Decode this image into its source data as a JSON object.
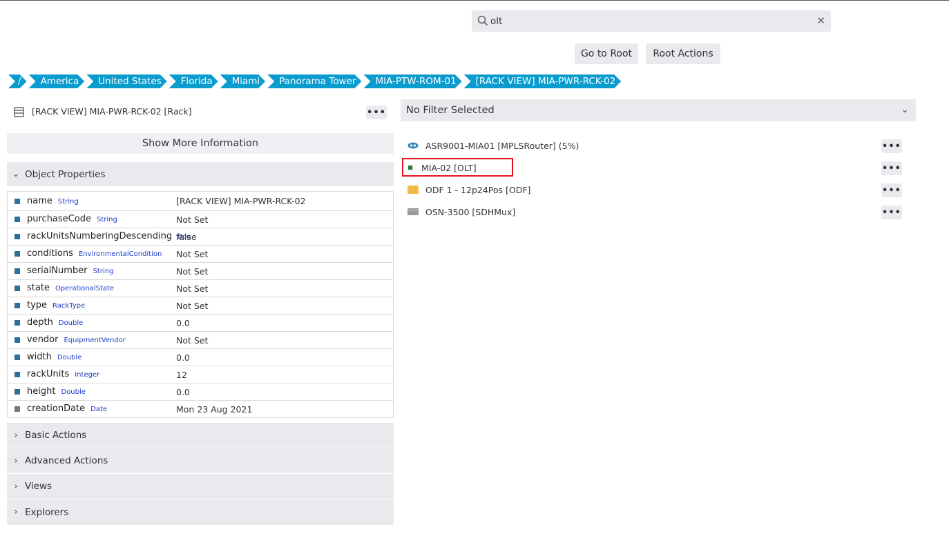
{
  "search": {
    "value": "olt"
  },
  "toolbar": {
    "go_root": "Go to Root",
    "root_actions": "Root Actions"
  },
  "breadcrumb": [
    "/",
    "America",
    "United States",
    "Florida",
    "Miami",
    "Panorama Tower",
    "MIA-PTW-ROM-01",
    "[RACK VIEW] MIA-PWR-RCK-02"
  ],
  "object": {
    "title": "[RACK VIEW] MIA-PWR-RCK-02 [Rack]",
    "more_info": "Show More Information",
    "properties_label": "Object Properties",
    "properties": [
      {
        "name": "name",
        "type": "String",
        "value": "[RACK VIEW] MIA-PWR-RCK-02"
      },
      {
        "name": "purchaseCode",
        "type": "String",
        "value": "Not Set"
      },
      {
        "name": "rackUnitsNumberingDescending",
        "type": "Boo",
        "value": "false"
      },
      {
        "name": "conditions",
        "type": "EnvironmentalCondition",
        "value": "Not Set"
      },
      {
        "name": "serialNumber",
        "type": "String",
        "value": "Not Set"
      },
      {
        "name": "state",
        "type": "OperationalState",
        "value": "Not Set"
      },
      {
        "name": "type",
        "type": "RackType",
        "value": "Not Set"
      },
      {
        "name": "depth",
        "type": "Double",
        "value": "0.0"
      },
      {
        "name": "vendor",
        "type": "EquipmentVendor",
        "value": "Not Set"
      },
      {
        "name": "width",
        "type": "Double",
        "value": "0.0"
      },
      {
        "name": "rackUnits",
        "type": "Integer",
        "value": "12"
      },
      {
        "name": "height",
        "type": "Double",
        "value": "0.0"
      },
      {
        "name": "creationDate",
        "type": "Date",
        "value": "Mon 23 Aug 2021"
      }
    ],
    "sections": [
      "Basic Actions",
      "Advanced Actions",
      "Views",
      "Explorers"
    ]
  },
  "filter": {
    "label": "No Filter Selected"
  },
  "children": [
    {
      "label": "ASR9001-MIA01 [MPLSRouter] (5%)",
      "icon": "router-icon"
    },
    {
      "label": "MIA-02 [OLT]",
      "icon": "olt-icon"
    },
    {
      "label": "ODF 1 - 12p24Pos [ODF]",
      "icon": "odf-icon"
    },
    {
      "label": "OSN-3500 [SDHMux]",
      "icon": "sdhmux-icon"
    }
  ],
  "colors": {
    "breadcrumb": "#0a9ccf",
    "highlight": "#e8131a",
    "olt": "#2e7d32",
    "prop_marker": "#2b6f9a",
    "type_text": "#1e40c8"
  }
}
